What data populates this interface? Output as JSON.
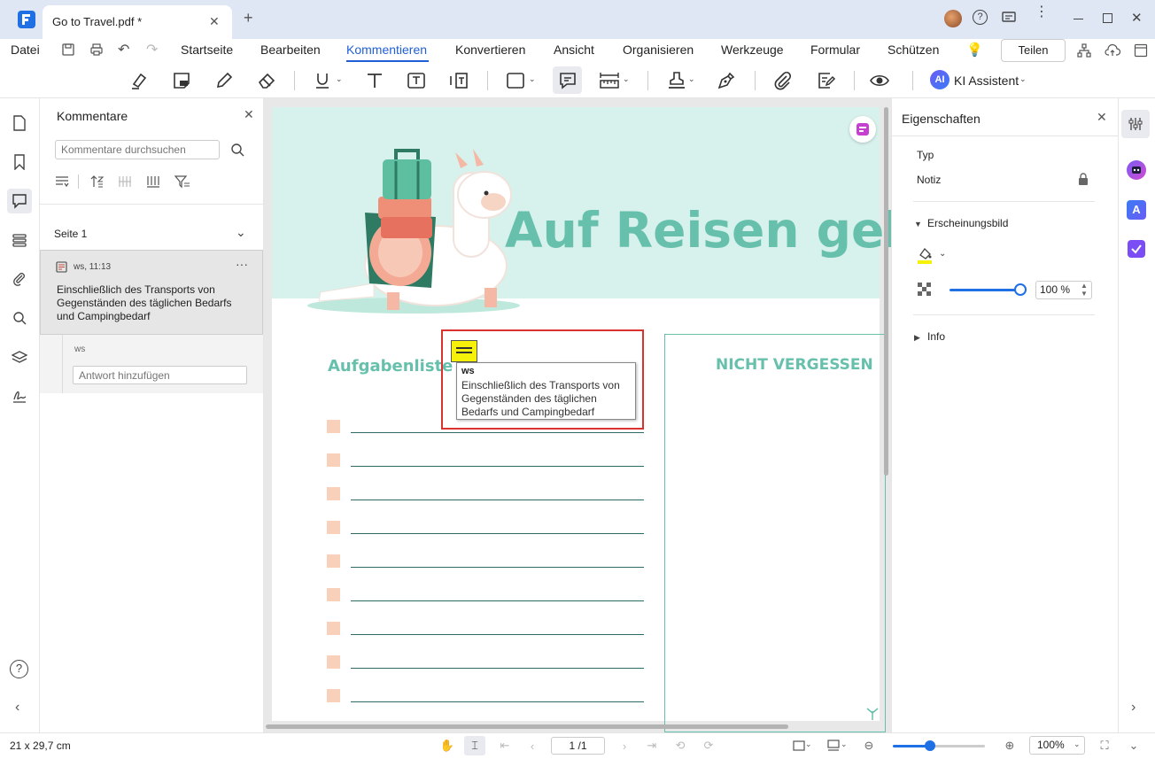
{
  "window": {
    "tab_title": "Go to Travel.pdf *"
  },
  "menu": {
    "file": "Datei",
    "items": [
      "Startseite",
      "Bearbeiten",
      "Kommentieren",
      "Konvertieren",
      "Ansicht",
      "Organisieren",
      "Werkzeuge",
      "Formular",
      "Schützen"
    ],
    "active": "Kommentieren",
    "share": "Teilen"
  },
  "toolbar": {
    "ai_badge": "AI",
    "ai_label": "KI Assistent"
  },
  "comments_panel": {
    "title": "Kommentare",
    "search_placeholder": "Kommentare durchsuchen",
    "page_label": "Seite 1",
    "comment": {
      "author_time": "ws,  11:13",
      "text": "Einschließlich des Transports von Gegenständen des täglichen Bedarfs und Campingbedarf"
    },
    "reply_author": "ws",
    "reply_placeholder": "Antwort hinzufügen"
  },
  "document": {
    "title": "Auf Reisen gehen",
    "tasks_title": "Aufgabenliste",
    "not_forget_title": "NICHT VERGESSEN",
    "checkbox_count_visible": 9,
    "note_popup": {
      "author": "ws",
      "text": "Einschließlich des Transports von Gegenständen des täglichen Bedarfs und Campingbedarf"
    }
  },
  "properties_panel": {
    "title": "Eigenschaften",
    "type_label": "Typ",
    "type_value": "Notiz",
    "appearance_label": "Erscheinungsbild",
    "opacity_value": "100 %",
    "info_label": "Info",
    "note_color": "#f6f10a"
  },
  "statusbar": {
    "page_size": "21 x 29,7 cm",
    "page_value": "1 /1",
    "zoom_value": "100%"
  },
  "colors": {
    "accent": "#1f5fd6",
    "teal": "#67c0ac",
    "selection": "#d9322f"
  }
}
